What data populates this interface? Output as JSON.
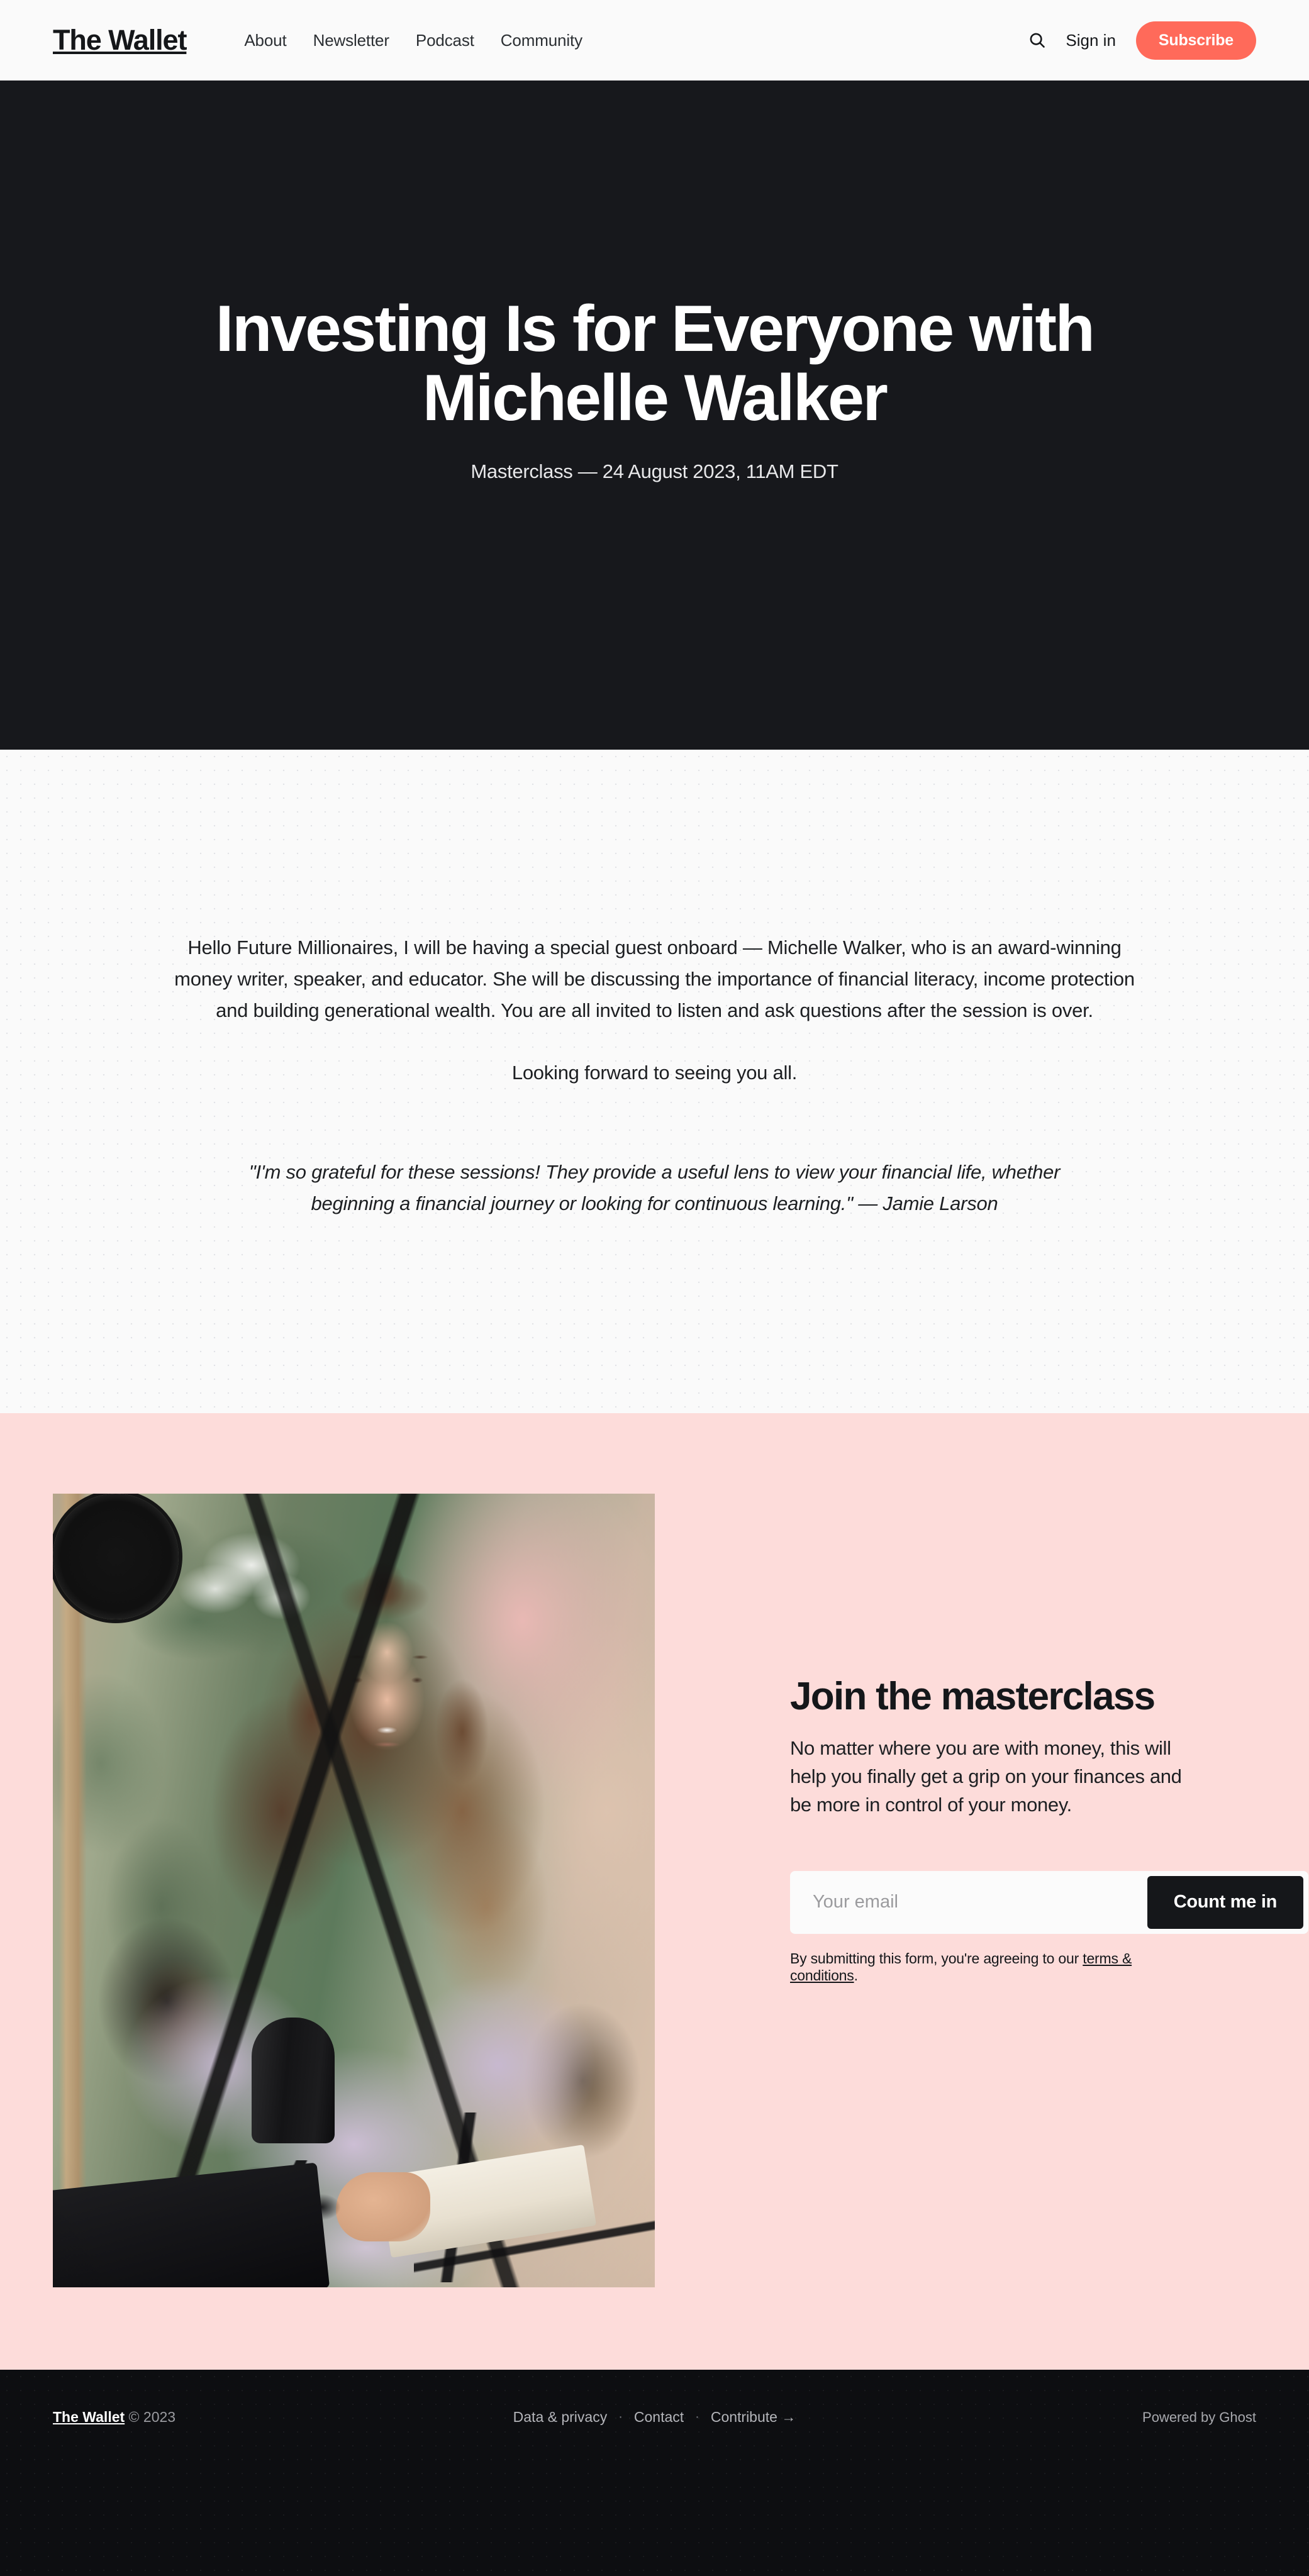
{
  "header": {
    "brand": "The Wallet",
    "nav": [
      {
        "label": "About"
      },
      {
        "label": "Newsletter"
      },
      {
        "label": "Podcast"
      },
      {
        "label": "Community"
      }
    ],
    "search_icon": "search-icon",
    "signin_label": "Sign in",
    "subscribe_label": "Subscribe",
    "accent_color": "#ff6a5a"
  },
  "hero": {
    "title": "Investing Is for Everyone with Michelle Walker",
    "meta": "Masterclass — 24 August 2023, 11AM EDT",
    "background_color": "#17181c"
  },
  "post": {
    "paragraph_1": "Hello Future Millionaires, I will be having a special guest onboard — Michelle Walker, who is an award-winning money writer, speaker, and educator. She will be discussing the importance of financial literacy, income protection and building generational wealth. You are all invited to listen and ask questions after the session is over.",
    "paragraph_2": "Looking forward to seeing you all.",
    "quote": "\"I'm so grateful for these sessions! They provide a useful lens to view your financial life, whether beginning a financial journey or looking for continuous learning.\" — Jamie Larson",
    "background_color": "#fafafa"
  },
  "cta": {
    "photo_alt": "Smiling woman with long brown hair in a lilac knit sweater sitting at a podcast microphone holding an open notebook, plants behind her",
    "title": "Join the masterclass",
    "subtitle": "No matter where you are with money, this will help you finally get a grip on your finances and be more in control of your money.",
    "email_placeholder": "Your email",
    "email_value": "",
    "submit_label": "Count me in",
    "fine_print_before": "By submitting this form, you're agreeing to our ",
    "fine_print_link": "terms & conditions",
    "fine_print_after": ".",
    "background_color": "#fddcda"
  },
  "footer": {
    "brand": "The Wallet",
    "copyright": " © 2023",
    "links": [
      {
        "label": "Data & privacy"
      },
      {
        "label": "Contact"
      },
      {
        "label": "Contribute →"
      }
    ],
    "separator": "·",
    "powered_by": "Powered by Ghost",
    "background_color": "#0d0e11"
  }
}
